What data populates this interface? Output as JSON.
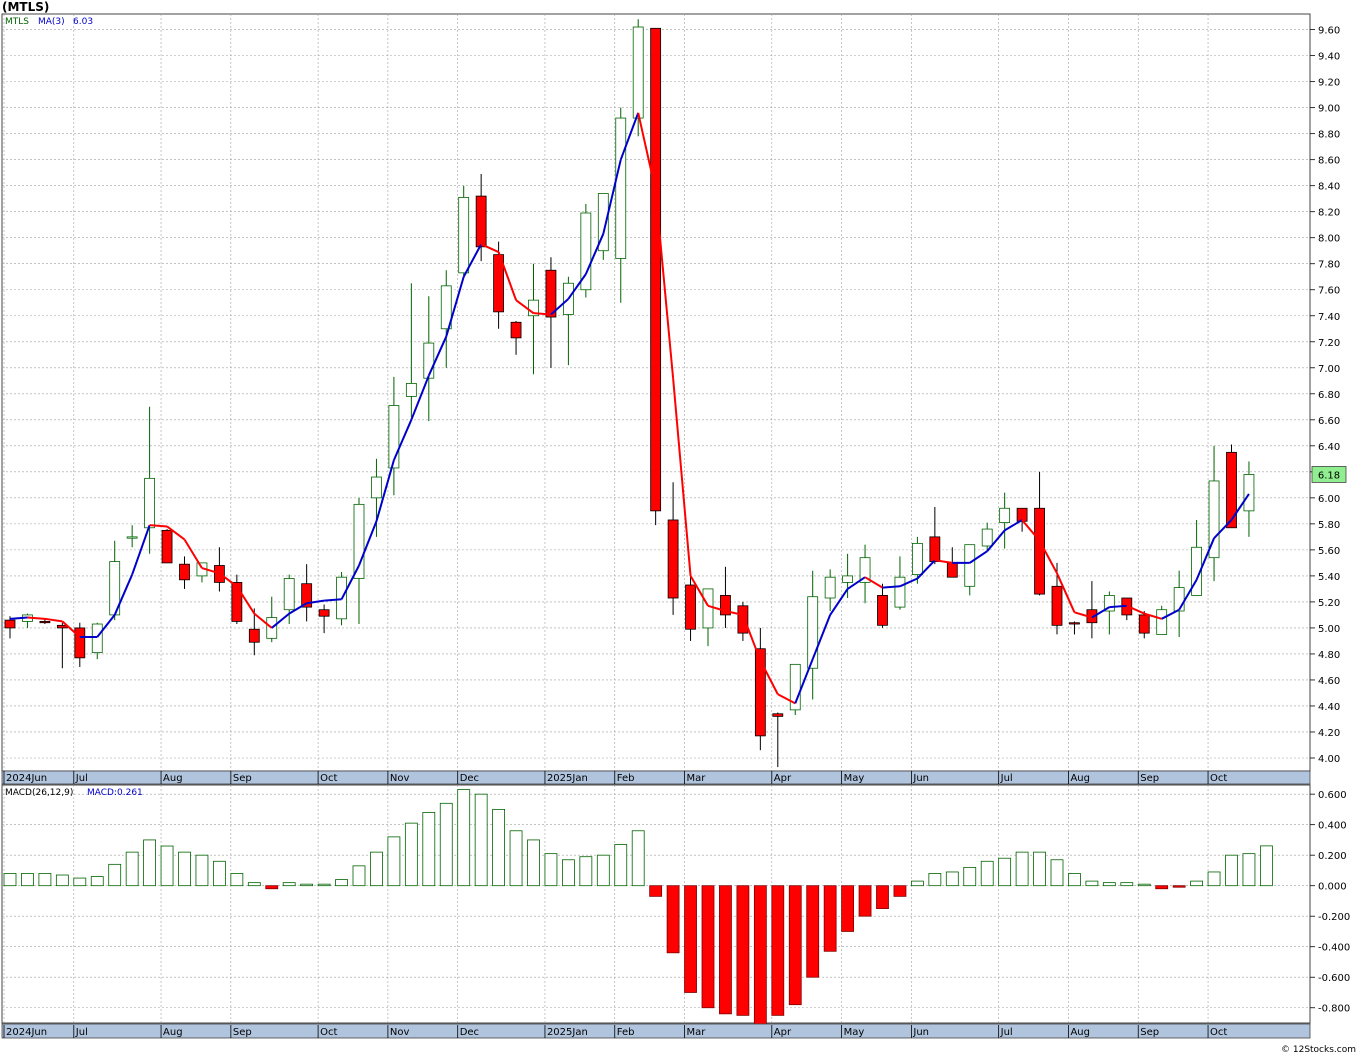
{
  "title": "(MTLS)",
  "watermark": "© 12Stocks.com",
  "price_panel": {
    "legend": {
      "symbol": "MTLS",
      "ma_label": "MA(3)",
      "ma_value": "6.03"
    },
    "last_price_label": "6.18"
  },
  "macd_panel": {
    "legend": {
      "label": "MACD(26,12,9)",
      "value_label": "MACD:0.261"
    }
  },
  "colors": {
    "up_candle_fill": "#ffffff",
    "up_candle_border": "#006400",
    "down_candle_fill": "#ff0000",
    "ma_up": "#0000cc",
    "ma_down": "#ff0000",
    "macd_pos_border": "#006400",
    "macd_neg_fill": "#ff0000",
    "date_strip": "#b0c4de",
    "grid": "#a0a0a0",
    "last_price_box": "#90ee90"
  },
  "chart_data": [
    {
      "type": "candlestick",
      "title": "(MTLS)",
      "ylim": [
        3.9,
        9.72
      ],
      "y_ticks": [
        "4.00",
        "4.20",
        "4.40",
        "4.60",
        "4.80",
        "5.00",
        "5.20",
        "5.40",
        "5.60",
        "5.80",
        "6.00",
        "6.20",
        "6.40",
        "6.60",
        "6.80",
        "7.00",
        "7.20",
        "7.40",
        "7.60",
        "7.80",
        "8.00",
        "8.20",
        "8.40",
        "8.60",
        "8.80",
        "9.00",
        "9.20",
        "9.40",
        "9.60"
      ],
      "x_labels": [
        {
          "label": "2024Jun",
          "week": 0
        },
        {
          "label": "Jul",
          "week": 4
        },
        {
          "label": "Aug",
          "week": 9
        },
        {
          "label": "Sep",
          "week": 13
        },
        {
          "label": "Oct",
          "week": 18
        },
        {
          "label": "Nov",
          "week": 22
        },
        {
          "label": "Dec",
          "week": 26
        },
        {
          "label": "2025Jan",
          "week": 31
        },
        {
          "label": "Feb",
          "week": 35
        },
        {
          "label": "Mar",
          "week": 39
        },
        {
          "label": "Apr",
          "week": 44
        },
        {
          "label": "May",
          "week": 48
        },
        {
          "label": "Jun",
          "week": 52
        },
        {
          "label": "Jul",
          "week": 57
        },
        {
          "label": "Aug",
          "week": 61
        },
        {
          "label": "Sep",
          "week": 65
        },
        {
          "label": "Oct",
          "week": 69
        }
      ],
      "grid": true,
      "candles": [
        [
          5.06,
          5.09,
          4.92,
          5.0
        ],
        [
          5.05,
          5.11,
          5.0,
          5.1
        ],
        [
          5.05,
          5.07,
          5.03,
          5.04
        ],
        [
          5.02,
          5.04,
          4.69,
          5.0
        ],
        [
          5.0,
          5.04,
          4.7,
          4.77
        ],
        [
          4.81,
          5.04,
          4.76,
          5.03
        ],
        [
          5.1,
          5.67,
          5.06,
          5.51
        ],
        [
          5.69,
          5.79,
          5.62,
          5.7
        ],
        [
          5.77,
          6.7,
          5.57,
          6.15
        ],
        [
          5.75,
          5.76,
          5.53,
          5.5
        ],
        [
          5.49,
          5.55,
          5.3,
          5.37
        ],
        [
          5.4,
          5.49,
          5.35,
          5.5
        ],
        [
          5.48,
          5.62,
          5.28,
          5.35
        ],
        [
          5.35,
          5.41,
          5.03,
          5.05
        ],
        [
          4.99,
          5.15,
          4.79,
          4.89
        ],
        [
          4.92,
          5.24,
          4.89,
          5.08
        ],
        [
          5.14,
          5.41,
          5.03,
          5.38
        ],
        [
          5.34,
          5.49,
          5.05,
          5.16
        ],
        [
          5.14,
          5.18,
          4.96,
          5.09
        ],
        [
          5.07,
          5.43,
          5.02,
          5.39
        ],
        [
          5.38,
          6.0,
          5.03,
          5.95
        ],
        [
          6.0,
          6.3,
          5.7,
          6.16
        ],
        [
          6.23,
          6.93,
          6.02,
          6.71
        ],
        [
          6.78,
          7.65,
          6.62,
          6.88
        ],
        [
          6.92,
          7.55,
          6.59,
          7.19
        ],
        [
          7.3,
          7.75,
          7.0,
          7.63
        ],
        [
          7.73,
          8.4,
          7.7,
          8.31
        ],
        [
          8.32,
          8.49,
          7.82,
          7.93
        ],
        [
          7.87,
          7.97,
          7.3,
          7.43
        ],
        [
          7.35,
          7.36,
          7.1,
          7.23
        ],
        [
          7.4,
          7.8,
          6.95,
          7.52
        ],
        [
          7.75,
          7.85,
          7.0,
          7.39
        ],
        [
          7.41,
          7.7,
          7.02,
          7.65
        ],
        [
          7.6,
          8.26,
          7.54,
          8.19
        ],
        [
          7.9,
          8.27,
          7.83,
          8.34
        ],
        [
          7.84,
          9.0,
          7.5,
          8.92
        ],
        [
          8.92,
          9.68,
          8.78,
          9.62
        ],
        [
          9.61,
          9.61,
          5.79,
          5.9
        ],
        [
          5.83,
          6.12,
          5.1,
          5.23
        ],
        [
          5.33,
          5.4,
          4.9,
          4.99
        ],
        [
          5.0,
          5.24,
          4.86,
          5.3
        ],
        [
          5.25,
          5.47,
          5.0,
          5.1
        ],
        [
          5.17,
          5.2,
          4.9,
          4.96
        ],
        [
          4.84,
          5.0,
          4.06,
          4.17
        ],
        [
          4.34,
          4.35,
          3.93,
          4.32
        ],
        [
          4.37,
          4.71,
          4.33,
          4.72
        ],
        [
          4.69,
          5.44,
          4.45,
          5.24
        ],
        [
          5.23,
          5.45,
          5.13,
          5.39
        ],
        [
          5.35,
          5.57,
          5.23,
          5.4
        ],
        [
          5.35,
          5.64,
          5.19,
          5.54
        ],
        [
          5.25,
          5.34,
          5.0,
          5.02
        ],
        [
          5.16,
          5.55,
          5.14,
          5.39
        ],
        [
          5.41,
          5.7,
          5.34,
          5.65
        ],
        [
          5.7,
          5.93,
          5.49,
          5.51
        ],
        [
          5.5,
          5.62,
          5.39,
          5.39
        ],
        [
          5.32,
          5.64,
          5.25,
          5.64
        ],
        [
          5.63,
          5.81,
          5.6,
          5.76
        ],
        [
          5.81,
          6.04,
          5.61,
          5.92
        ],
        [
          5.92,
          5.89,
          5.74,
          5.82
        ],
        [
          5.92,
          6.2,
          5.25,
          5.26
        ],
        [
          5.32,
          5.5,
          4.95,
          5.02
        ],
        [
          5.04,
          5.05,
          4.95,
          5.03
        ],
        [
          5.14,
          5.36,
          4.92,
          5.04
        ],
        [
          5.13,
          5.28,
          4.95,
          5.25
        ],
        [
          5.23,
          5.23,
          5.06,
          5.1
        ],
        [
          5.1,
          5.13,
          4.92,
          4.96
        ],
        [
          4.95,
          5.17,
          4.95,
          5.14
        ],
        [
          5.13,
          5.44,
          4.93,
          5.31
        ],
        [
          5.25,
          5.83,
          5.25,
          5.62
        ],
        [
          5.54,
          6.4,
          5.36,
          6.13
        ],
        [
          6.35,
          6.41,
          5.79,
          5.77
        ],
        [
          5.9,
          6.28,
          5.7,
          6.18
        ]
      ],
      "ma3": [
        5.07,
        5.08,
        5.07,
        5.05,
        4.93,
        4.93,
        5.1,
        5.41,
        5.79,
        5.78,
        5.68,
        5.46,
        5.42,
        5.32,
        5.11,
        5.0,
        5.11,
        5.19,
        5.21,
        5.22,
        5.48,
        5.82,
        6.29,
        6.6,
        6.94,
        7.24,
        7.7,
        7.95,
        7.89,
        7.52,
        7.42,
        7.41,
        7.53,
        7.72,
        8.03,
        8.6,
        8.96,
        8.36,
        6.92,
        5.4,
        5.17,
        5.13,
        5.1,
        4.75,
        4.49,
        4.42,
        4.76,
        5.1,
        5.3,
        5.39,
        5.31,
        5.32,
        5.38,
        5.52,
        5.5,
        5.5,
        5.59,
        5.75,
        5.83,
        5.67,
        5.42,
        5.12,
        5.08,
        5.16,
        5.17,
        5.11,
        5.07,
        5.14,
        5.37,
        5.69,
        5.83,
        6.03
      ]
    },
    {
      "type": "bar",
      "title": "MACD(26,12,9)",
      "ylim": [
        -0.9,
        0.66
      ],
      "y_ticks": [
        "0.600",
        "0.400",
        "0.200",
        "0.000",
        "-0.200",
        "-0.400",
        "-0.600",
        "-0.800"
      ],
      "values": [
        0.08,
        0.08,
        0.08,
        0.07,
        0.05,
        0.06,
        0.14,
        0.22,
        0.3,
        0.26,
        0.22,
        0.2,
        0.16,
        0.08,
        0.02,
        -0.02,
        0.02,
        0.01,
        0.01,
        0.04,
        0.13,
        0.22,
        0.32,
        0.41,
        0.48,
        0.54,
        0.63,
        0.6,
        0.5,
        0.36,
        0.3,
        0.21,
        0.17,
        0.19,
        0.2,
        0.27,
        0.36,
        -0.07,
        -0.44,
        -0.7,
        -0.8,
        -0.84,
        -0.85,
        -0.91,
        -0.85,
        -0.78,
        -0.6,
        -0.43,
        -0.3,
        -0.2,
        -0.15,
        -0.07,
        0.03,
        0.08,
        0.09,
        0.12,
        0.16,
        0.18,
        0.22,
        0.22,
        0.17,
        0.08,
        0.03,
        0.02,
        0.02,
        0.01,
        -0.02,
        -0.01,
        0.03,
        0.09,
        0.2,
        0.21,
        0.261
      ]
    }
  ]
}
